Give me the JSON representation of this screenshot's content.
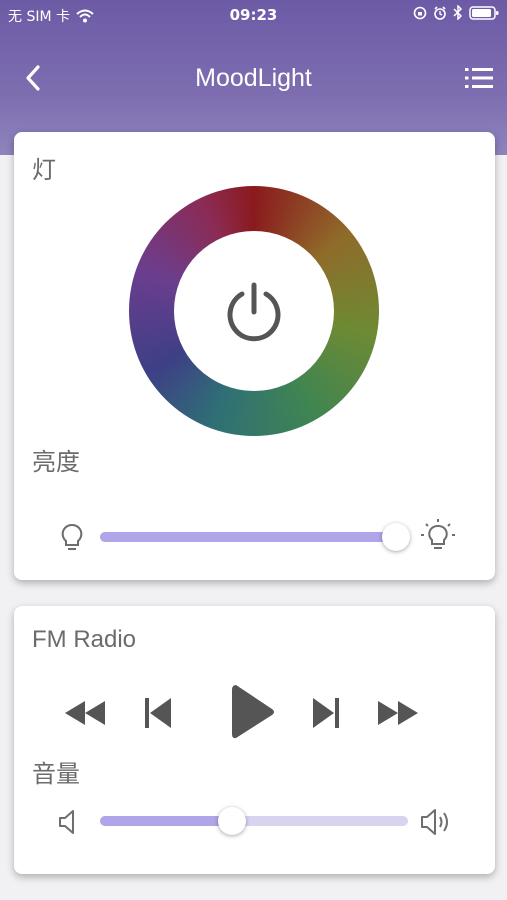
{
  "status_bar": {
    "carrier": "无 SIM 卡",
    "time": "09:23",
    "icons": [
      "wifi-icon",
      "orientation-lock-icon",
      "alarm-icon",
      "bluetooth-icon",
      "battery-icon"
    ]
  },
  "nav": {
    "title": "MoodLight",
    "back_icon": "back-icon",
    "menu_icon": "list-menu-icon"
  },
  "light_card": {
    "label": "灯",
    "power_icon": "power-icon",
    "brightness_label": "亮度",
    "brightness_value": 1.0,
    "brightness_icons": [
      "bulb-dim-icon",
      "bulb-bright-icon"
    ]
  },
  "radio_card": {
    "label": "FM Radio",
    "controls": [
      "rewind-icon",
      "previous-icon",
      "play-icon",
      "next-icon",
      "fast-forward-icon"
    ],
    "volume_label": "音量",
    "volume_value": 0.43,
    "volume_icons": [
      "volume-low-icon",
      "volume-high-icon"
    ]
  },
  "colors": {
    "header": "#6d5aa6",
    "slider_fill": "#b0a5e8",
    "slider_track": "#d8d3ef",
    "icon_gray": "#555555"
  }
}
